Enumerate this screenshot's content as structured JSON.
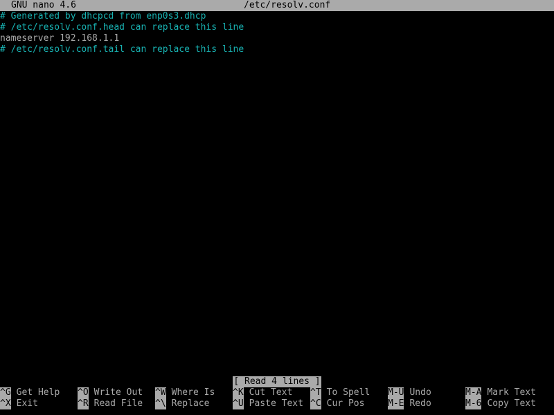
{
  "title_bar": {
    "app": "GNU nano 4.6",
    "filename": "/etc/resolv.conf"
  },
  "colors": {
    "bar_bg": "#aaaaaa",
    "text": "#aaaaaa",
    "comment": "#18b2b2",
    "background": "#000000"
  },
  "buffer": {
    "lines": [
      {
        "text": "# Generated by dhcpcd from enp0s3.dhcp",
        "type": "comment"
      },
      {
        "text": "# /etc/resolv.conf.head can replace this line",
        "type": "comment"
      },
      {
        "text": "nameserver 192.168.1.1",
        "type": "text"
      },
      {
        "text": "# /etc/resolv.conf.tail can replace this line",
        "type": "comment"
      }
    ]
  },
  "status": "[ Read 4 lines ]",
  "shortcuts": {
    "row1": [
      {
        "key": "^G",
        "label": "Get Help"
      },
      {
        "key": "^O",
        "label": "Write Out"
      },
      {
        "key": "^W",
        "label": "Where Is"
      },
      {
        "key": "^K",
        "label": "Cut Text"
      },
      {
        "key": "^T",
        "label": "To Spell"
      },
      {
        "key": "M-U",
        "label": "Undo"
      },
      {
        "key": "M-A",
        "label": "Mark Text"
      }
    ],
    "row2": [
      {
        "key": "^X",
        "label": "Exit"
      },
      {
        "key": "^R",
        "label": "Read File"
      },
      {
        "key": "^\\",
        "label": "Replace"
      },
      {
        "key": "^U",
        "label": "Paste Text"
      },
      {
        "key": "^C",
        "label": "Cur Pos"
      },
      {
        "key": "M-E",
        "label": "Redo"
      },
      {
        "key": "M-6",
        "label": "Copy Text"
      }
    ]
  }
}
